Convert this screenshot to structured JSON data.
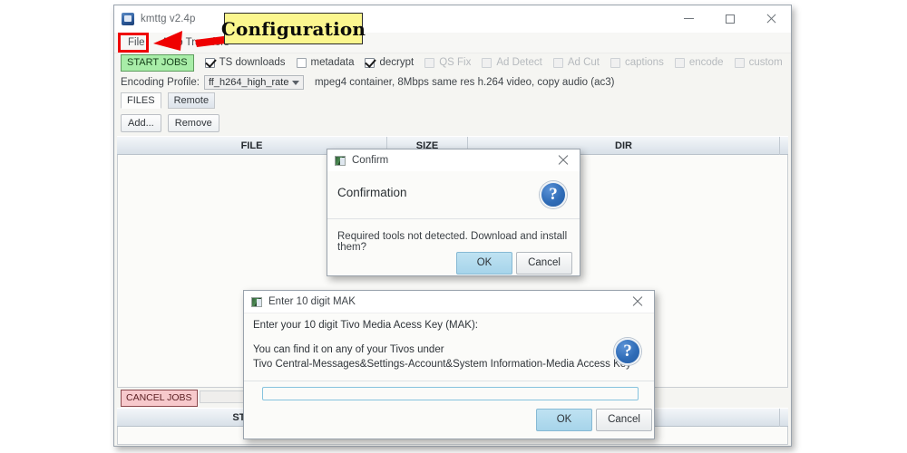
{
  "app": {
    "title": "kmttg v2.4p",
    "icon": "tivo-app-icon",
    "window_controls": {
      "minimize": "minimize-icon",
      "maximize": "maximize-icon",
      "close": "close-icon"
    }
  },
  "menu": {
    "items": [
      {
        "label": "File"
      },
      {
        "label": "Auto Transfers"
      }
    ]
  },
  "toolbar": {
    "start_jobs_label": "START JOBS",
    "checkboxes": [
      {
        "label": "TS downloads",
        "checked": true,
        "enabled": true
      },
      {
        "label": "metadata",
        "checked": false,
        "enabled": true
      },
      {
        "label": "decrypt",
        "checked": true,
        "enabled": true
      },
      {
        "label": "QS Fix",
        "checked": false,
        "enabled": false
      },
      {
        "label": "Ad Detect",
        "checked": false,
        "enabled": false
      },
      {
        "label": "Ad Cut",
        "checked": false,
        "enabled": false
      },
      {
        "label": "captions",
        "checked": false,
        "enabled": false
      },
      {
        "label": "encode",
        "checked": false,
        "enabled": false
      },
      {
        "label": "custom",
        "checked": false,
        "enabled": false
      }
    ]
  },
  "encoding": {
    "label": "Encoding Profile:",
    "selected": "ff_h264_high_rate",
    "dropdown_icon": "chevron-down-icon",
    "description": "mpeg4 container, 8Mbps same res h.264 video, copy audio (ac3)"
  },
  "tabs": [
    {
      "label": "FILES",
      "active": true
    },
    {
      "label": "Remote",
      "active": false
    }
  ],
  "file_buttons": [
    {
      "label": "Add..."
    },
    {
      "label": "Remove"
    }
  ],
  "file_table": {
    "columns": [
      "FILE",
      "SIZE",
      "DIR"
    ],
    "rows": []
  },
  "jobs": {
    "cancel_label": "CANCEL JOBS",
    "progress_value": 0
  },
  "status_table": {
    "columns": [
      "STATUS"
    ],
    "rows": []
  },
  "confirm_dialog": {
    "title": "Confirm",
    "title_icon": "dialog-window-icon",
    "close_icon": "close-icon",
    "heading": "Confirmation",
    "question_icon": "question-mark-icon",
    "message": "Required tools not detected. Download and install them?",
    "ok_label": "OK",
    "cancel_label": "Cancel"
  },
  "mak_dialog": {
    "title": "Enter 10 digit MAK",
    "title_icon": "dialog-window-icon",
    "close_icon": "close-icon",
    "line1": "Enter your 10 digit Tivo Media Acess Key (MAK):",
    "line2": "You can find it on any of your Tivos under",
    "line3": "Tivo Central-Messages&Settings-Account&System Information-Media Access Key",
    "question_icon": "question-mark-icon",
    "input_value": "",
    "input_placeholder": "",
    "ok_label": "OK",
    "cancel_label": "Cancel"
  },
  "annotations": {
    "callout_text": "Configuration",
    "callout_bg": "#fbf68e",
    "highlight_color": "#ef0000",
    "arrow": "red-arrow-pointing-to-file-menu"
  }
}
